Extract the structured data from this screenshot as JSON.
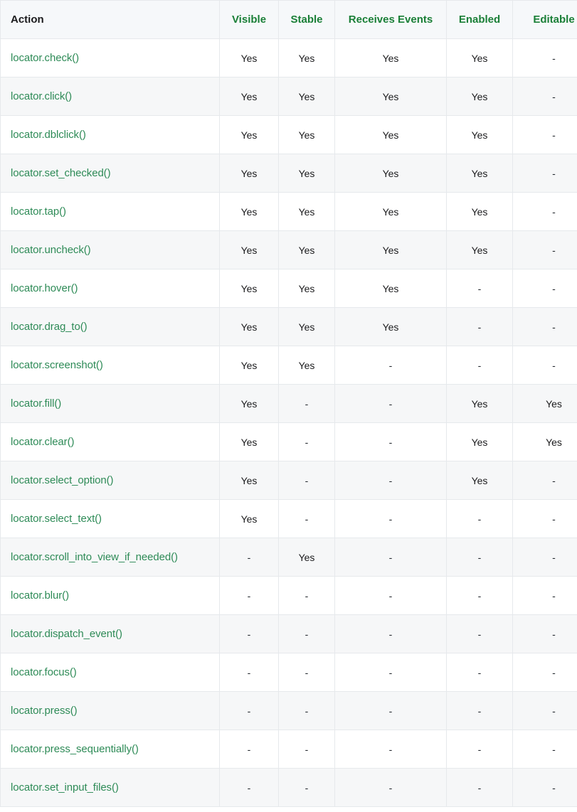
{
  "table": {
    "name": "actionability-matrix",
    "columns": [
      {
        "key": "action",
        "label": "Action",
        "align": "left"
      },
      {
        "key": "visible",
        "label": "Visible",
        "align": "center"
      },
      {
        "key": "stable",
        "label": "Stable",
        "align": "center"
      },
      {
        "key": "events",
        "label": "Receives Events",
        "align": "center"
      },
      {
        "key": "enabled",
        "label": "Enabled",
        "align": "center"
      },
      {
        "key": "editable",
        "label": "Editable",
        "align": "center"
      }
    ],
    "yes_label": "Yes",
    "dash_label": "-",
    "rows": [
      {
        "action": "locator.check()",
        "visible": "Yes",
        "stable": "Yes",
        "events": "Yes",
        "enabled": "Yes",
        "editable": "-"
      },
      {
        "action": "locator.click()",
        "visible": "Yes",
        "stable": "Yes",
        "events": "Yes",
        "enabled": "Yes",
        "editable": "-"
      },
      {
        "action": "locator.dblclick()",
        "visible": "Yes",
        "stable": "Yes",
        "events": "Yes",
        "enabled": "Yes",
        "editable": "-"
      },
      {
        "action": "locator.set_checked()",
        "visible": "Yes",
        "stable": "Yes",
        "events": "Yes",
        "enabled": "Yes",
        "editable": "-"
      },
      {
        "action": "locator.tap()",
        "visible": "Yes",
        "stable": "Yes",
        "events": "Yes",
        "enabled": "Yes",
        "editable": "-"
      },
      {
        "action": "locator.uncheck()",
        "visible": "Yes",
        "stable": "Yes",
        "events": "Yes",
        "enabled": "Yes",
        "editable": "-"
      },
      {
        "action": "locator.hover()",
        "visible": "Yes",
        "stable": "Yes",
        "events": "Yes",
        "enabled": "-",
        "editable": "-"
      },
      {
        "action": "locator.drag_to()",
        "visible": "Yes",
        "stable": "Yes",
        "events": "Yes",
        "enabled": "-",
        "editable": "-"
      },
      {
        "action": "locator.screenshot()",
        "visible": "Yes",
        "stable": "Yes",
        "events": "-",
        "enabled": "-",
        "editable": "-"
      },
      {
        "action": "locator.fill()",
        "visible": "Yes",
        "stable": "-",
        "events": "-",
        "enabled": "Yes",
        "editable": "Yes"
      },
      {
        "action": "locator.clear()",
        "visible": "Yes",
        "stable": "-",
        "events": "-",
        "enabled": "Yes",
        "editable": "Yes"
      },
      {
        "action": "locator.select_option()",
        "visible": "Yes",
        "stable": "-",
        "events": "-",
        "enabled": "Yes",
        "editable": "-"
      },
      {
        "action": "locator.select_text()",
        "visible": "Yes",
        "stable": "-",
        "events": "-",
        "enabled": "-",
        "editable": "-"
      },
      {
        "action": "locator.scroll_into_view_if_needed()",
        "visible": "-",
        "stable": "Yes",
        "events": "-",
        "enabled": "-",
        "editable": "-"
      },
      {
        "action": "locator.blur()",
        "visible": "-",
        "stable": "-",
        "events": "-",
        "enabled": "-",
        "editable": "-"
      },
      {
        "action": "locator.dispatch_event()",
        "visible": "-",
        "stable": "-",
        "events": "-",
        "enabled": "-",
        "editable": "-"
      },
      {
        "action": "locator.focus()",
        "visible": "-",
        "stable": "-",
        "events": "-",
        "enabled": "-",
        "editable": "-"
      },
      {
        "action": "locator.press()",
        "visible": "-",
        "stable": "-",
        "events": "-",
        "enabled": "-",
        "editable": "-"
      },
      {
        "action": "locator.press_sequentially()",
        "visible": "-",
        "stable": "-",
        "events": "-",
        "enabled": "-",
        "editable": "-"
      },
      {
        "action": "locator.set_input_files()",
        "visible": "-",
        "stable": "-",
        "events": "-",
        "enabled": "-",
        "editable": "-"
      }
    ]
  },
  "colors": {
    "header_accent": "#1a7f37",
    "header_action": "#1b1b1d",
    "api_link": "#2e8b57",
    "row_alt_bg": "#f6f7f8",
    "header_bg": "#f6f8fa",
    "border": "#e6e9ec",
    "value_text": "#1b1b1d"
  }
}
